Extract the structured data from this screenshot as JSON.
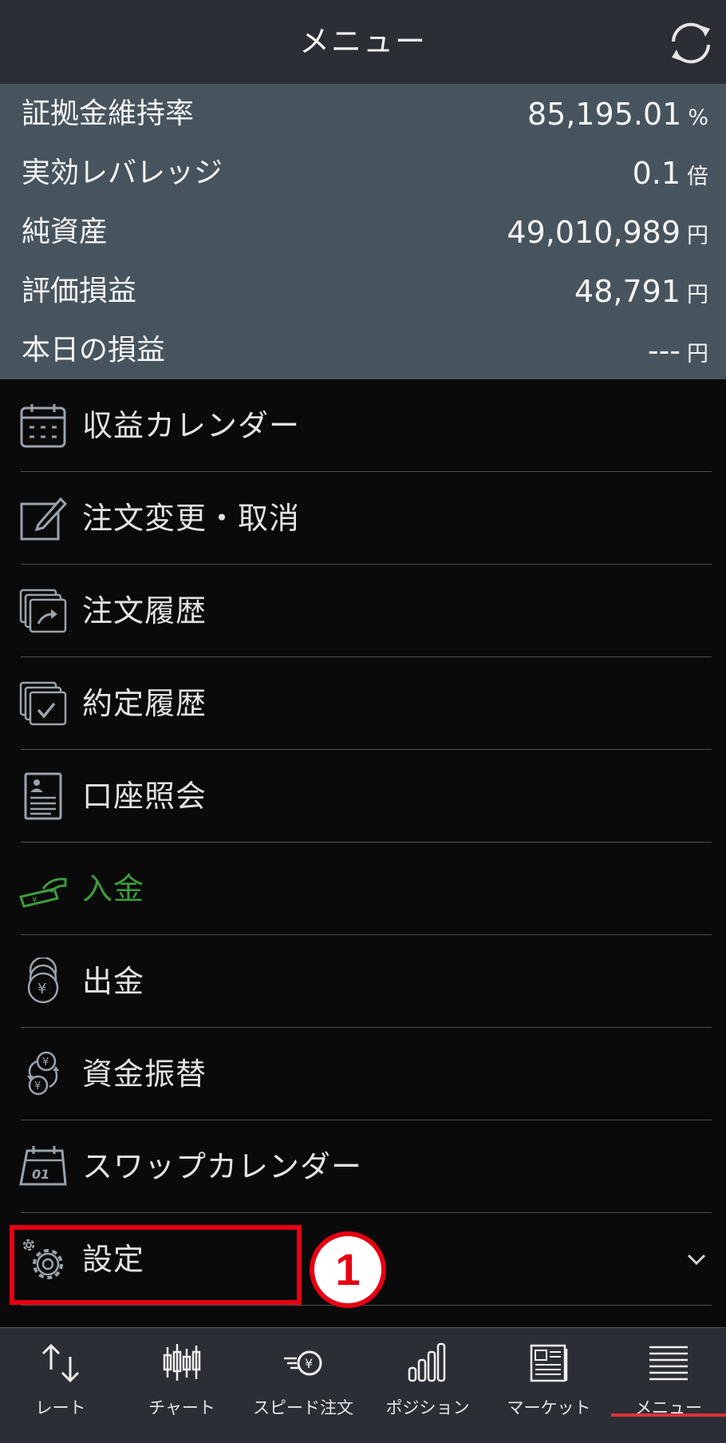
{
  "header": {
    "title": "メニュー",
    "refresh_icon": "refresh-icon"
  },
  "summary": [
    {
      "label": "証拠金維持率",
      "value": "85,195.01",
      "unit": "%"
    },
    {
      "label": "実効レバレッジ",
      "value": "0.1",
      "unit": "倍"
    },
    {
      "label": "純資産",
      "value": "49,010,989",
      "unit": "円"
    },
    {
      "label": "評価損益",
      "value": "48,791",
      "unit": "円"
    },
    {
      "label": "本日の損益",
      "value": "---",
      "unit": "円"
    }
  ],
  "menu": [
    {
      "label": "収益カレンダー",
      "icon": "calendar-icon"
    },
    {
      "label": "注文変更・取消",
      "icon": "edit-order-icon"
    },
    {
      "label": "注文履歴",
      "icon": "order-history-icon"
    },
    {
      "label": "約定履歴",
      "icon": "execution-history-icon"
    },
    {
      "label": "口座照会",
      "icon": "account-inquiry-icon"
    },
    {
      "label": "入金",
      "icon": "deposit-icon",
      "color": "#3f9a3d"
    },
    {
      "label": "出金",
      "icon": "withdraw-coins-icon"
    },
    {
      "label": "資金振替",
      "icon": "fund-transfer-icon"
    },
    {
      "label": "スワップカレンダー",
      "icon": "swap-calendar-icon"
    },
    {
      "label": "設定",
      "icon": "settings-gear-icon",
      "expandable": true
    }
  ],
  "annotation": {
    "step_number": "1",
    "accent_color": "#e50012"
  },
  "tabs": [
    {
      "label": "レート",
      "icon": "rate-arrows-icon"
    },
    {
      "label": "チャート",
      "icon": "candlestick-chart-icon"
    },
    {
      "label": "スピード注文",
      "icon": "speed-order-icon"
    },
    {
      "label": "ポジション",
      "icon": "position-bars-icon"
    },
    {
      "label": "マーケット",
      "icon": "market-news-icon"
    },
    {
      "label": "メニュー",
      "icon": "menu-list-icon",
      "active": true
    }
  ]
}
